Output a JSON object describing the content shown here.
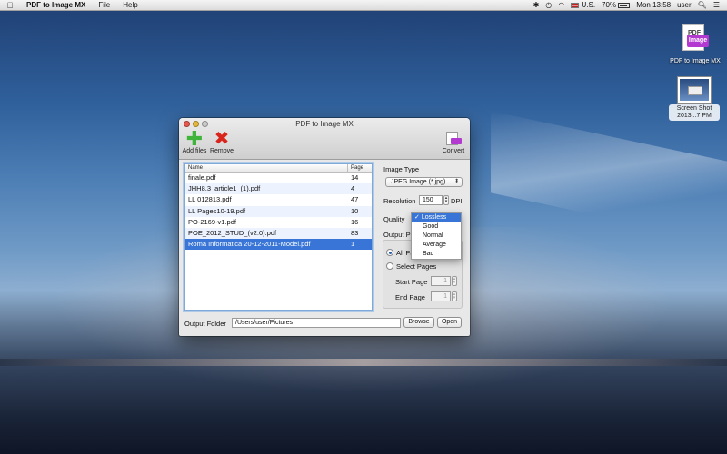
{
  "menubar": {
    "apple": "",
    "app_name": "PDF to Image MX",
    "menus": [
      "File",
      "Help"
    ],
    "status": {
      "input_source": "U.S.",
      "battery": "70%",
      "clock": "Mon 13:58",
      "user": "user"
    }
  },
  "desktop": {
    "app_icon": {
      "label": "PDF to Image MX",
      "badge": "Image",
      "page_text": "PDF"
    },
    "screenshot_icon": {
      "label_line1": "Screen Shot",
      "label_line2": "2013...7 PM"
    }
  },
  "window": {
    "title": "PDF to Image MX",
    "toolbar": {
      "add_label": "Add files",
      "remove_label": "Remove",
      "convert_label": "Convert"
    },
    "file_list": {
      "columns": [
        "Name",
        "Page"
      ],
      "rows": [
        {
          "name": "finale.pdf",
          "page": "14"
        },
        {
          "name": "JHH8.3_article1_(1).pdf",
          "page": "4"
        },
        {
          "name": "LL 012813.pdf",
          "page": "47"
        },
        {
          "name": "LL Pages10-19.pdf",
          "page": "10"
        },
        {
          "name": "PO-2169-v1.pdf",
          "page": "16"
        },
        {
          "name": "POE_2012_STUD_(v2.0).pdf",
          "page": "83"
        },
        {
          "name": "Roma Informatica 20-12-2011-Model.pdf",
          "page": "1"
        }
      ],
      "selected_row": "Roma Informatica 20-12-2011-Model.pdf"
    },
    "settings": {
      "image_type_label": "Image Type",
      "image_type_value": "JPEG Image (*.jpg)",
      "resolution_label": "Resolution",
      "resolution_value": "150",
      "resolution_unit": "DPI",
      "quality_label": "Quality",
      "quality_options": [
        "Lossless",
        "Good",
        "Normal",
        "Average",
        "Bad"
      ],
      "quality_selected": "Lossless",
      "output_pages_label": "Output P",
      "all_pages_label": "All Pa",
      "select_pages_label": "Select Pages",
      "start_page_label": "Start Page",
      "start_page_value": "1",
      "end_page_label": "End Page",
      "end_page_value": "1"
    },
    "output": {
      "label": "Output Folder",
      "path": "/Users/user/Pictures",
      "browse_label": "Browse",
      "open_label": "Open"
    }
  }
}
